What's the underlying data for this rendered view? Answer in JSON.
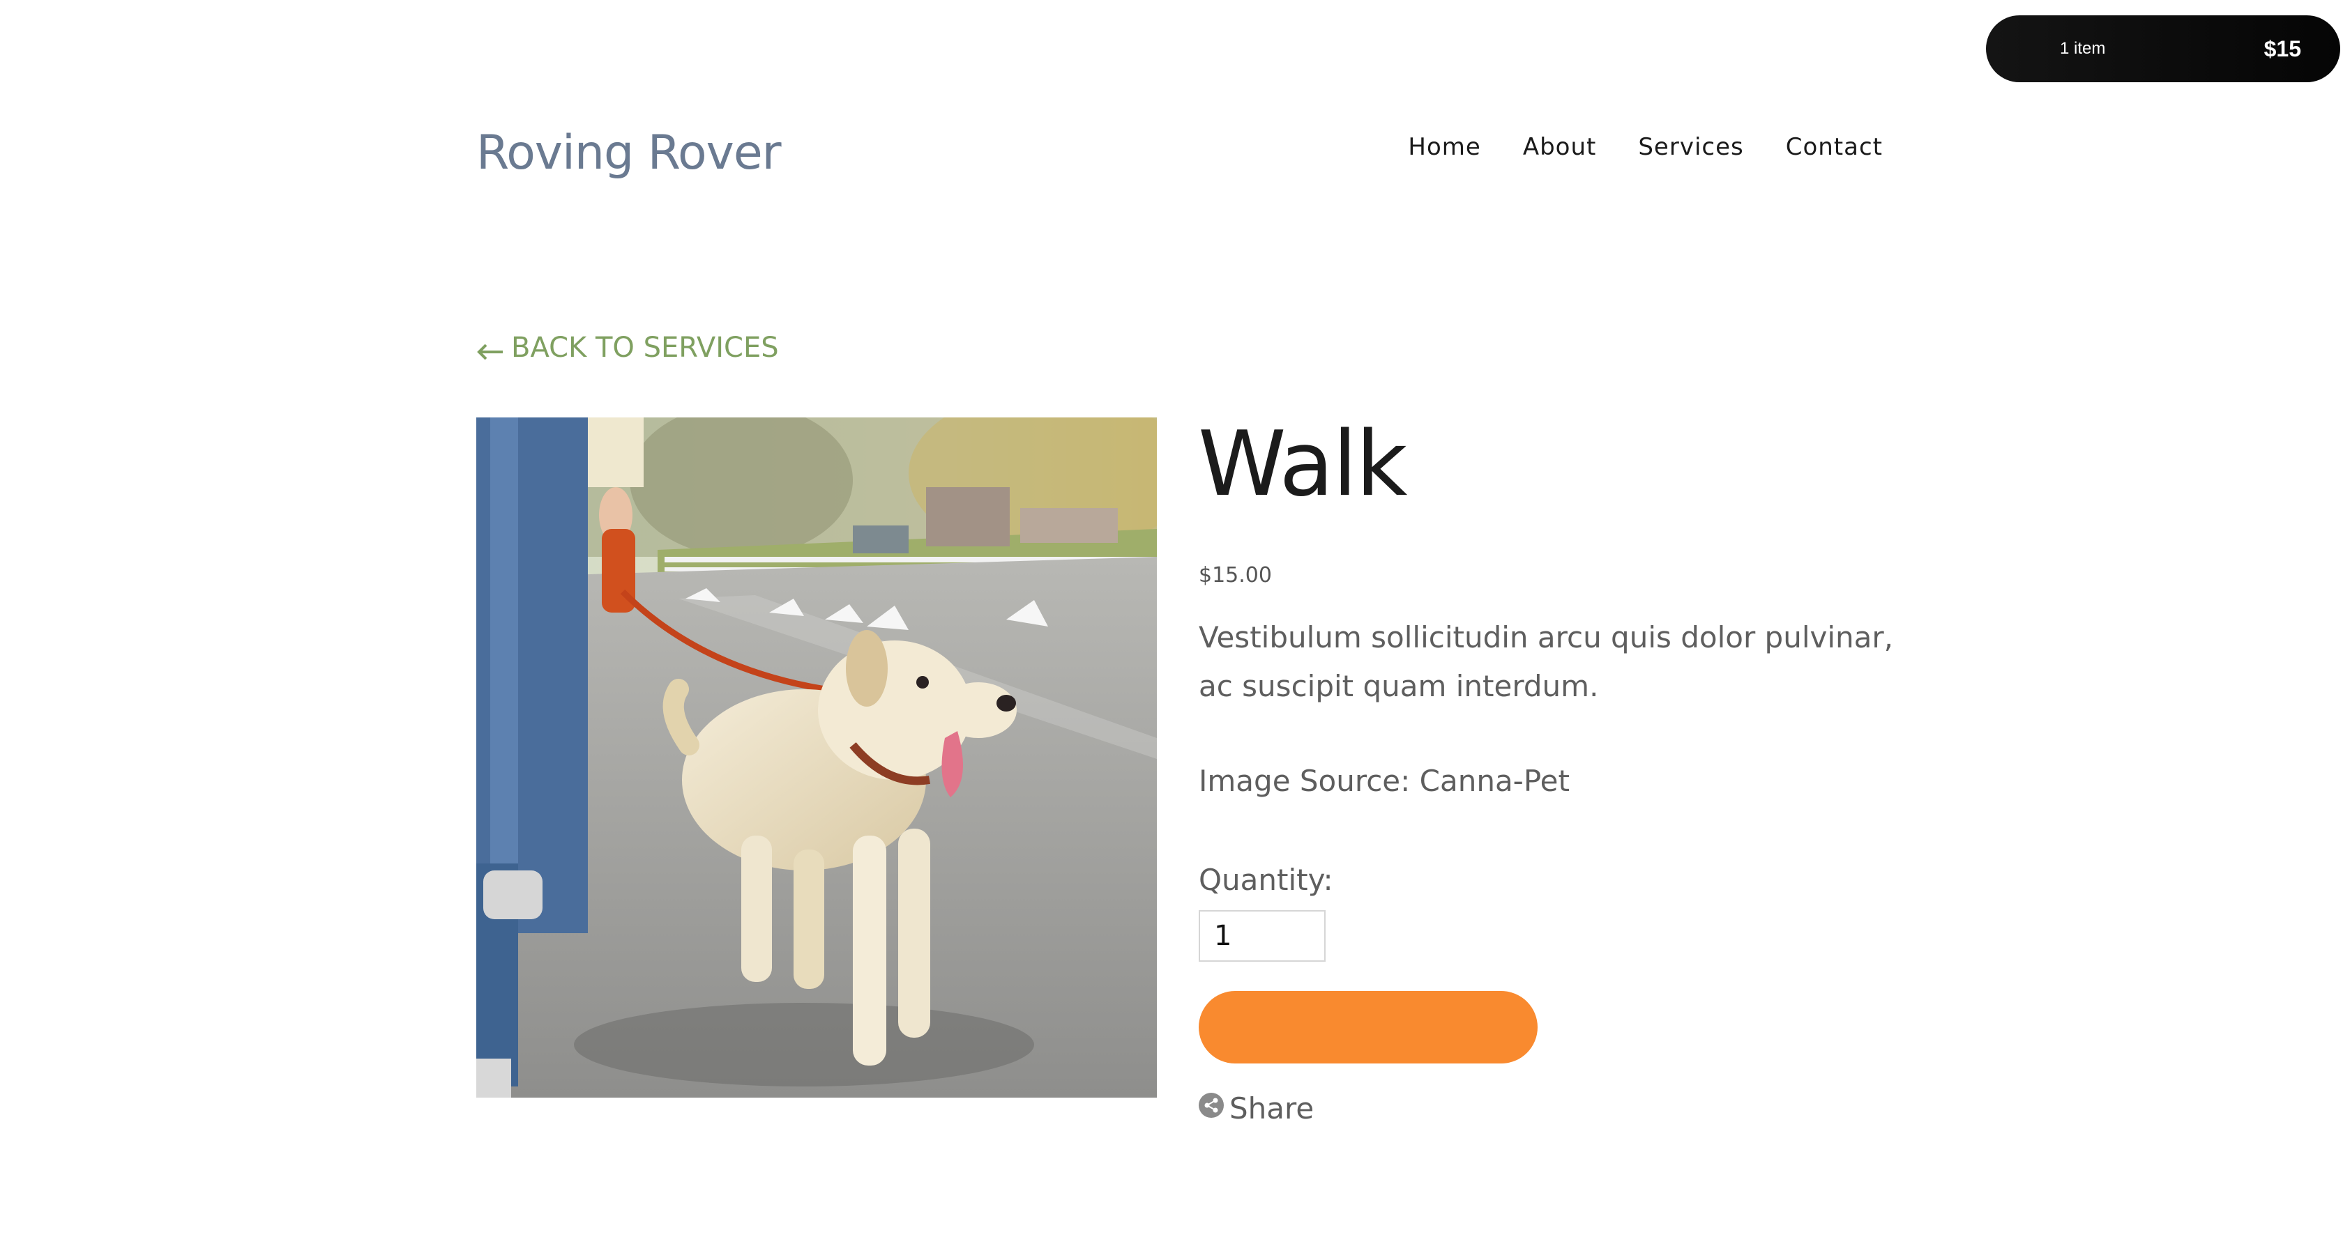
{
  "cart": {
    "count_label": "1 item",
    "total": "$15"
  },
  "header": {
    "site_title": "Roving Rover",
    "nav": [
      "Home",
      "About",
      "Services",
      "Contact"
    ]
  },
  "back_link": {
    "label": "BACK TO SERVICES",
    "icon": "arrow-left-icon"
  },
  "product": {
    "title": "Walk",
    "price": "$15.00",
    "description": "Vestibulum sollicitudin arcu quis dolor pulvinar, ac suscipit quam interdum.",
    "image_source": "Image Source: Canna-Pet",
    "quantity_label": "Quantity:",
    "quantity_value": "1",
    "add_button_label": "",
    "share_label": "Share",
    "share_icon": "share-icon"
  },
  "colors": {
    "accent_orange": "#f98a2f",
    "back_link_green": "#7fa060",
    "title_slate": "#6a7a91",
    "cart_bg": "#0b0b0b"
  }
}
